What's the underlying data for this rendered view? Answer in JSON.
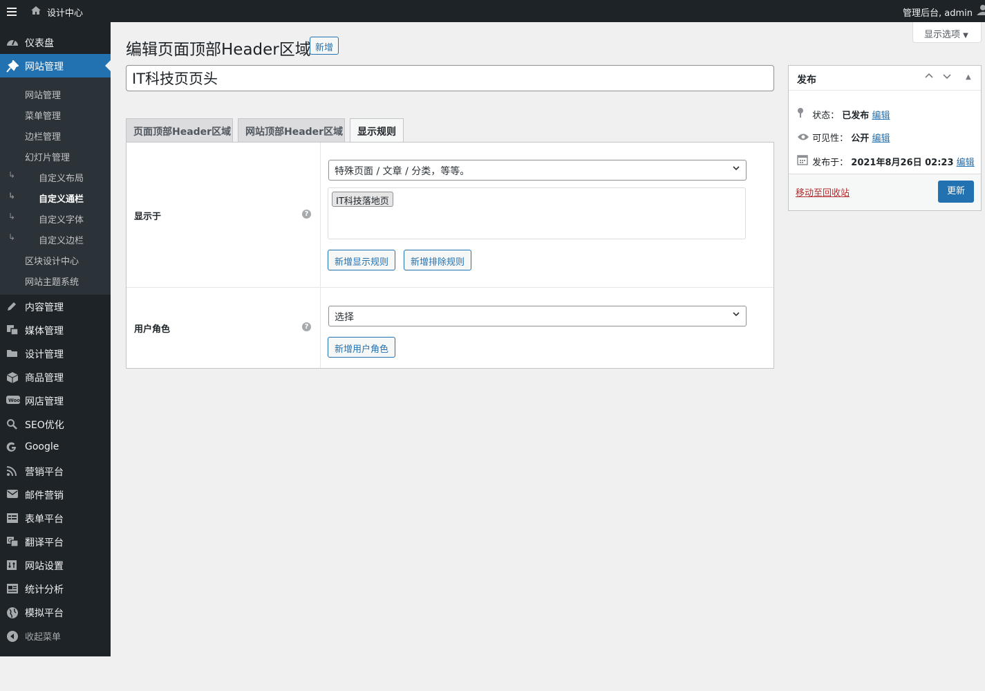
{
  "adminbar": {
    "site_name": "设计中心",
    "account": "管理后台, admin"
  },
  "sidebar": {
    "items_top": [
      {
        "label": "仪表盘",
        "icon": "dashboard-icon"
      },
      {
        "label": "网站管理",
        "icon": "pin-icon",
        "current": true
      }
    ],
    "submenu": [
      {
        "label": "网站管理"
      },
      {
        "label": "菜单管理"
      },
      {
        "label": "边栏管理"
      },
      {
        "label": "幻灯片管理"
      },
      {
        "label": "自定义布局",
        "indent": true
      },
      {
        "label": "自定义通栏",
        "indent": true,
        "active": true
      },
      {
        "label": "自定义字体",
        "indent": true
      },
      {
        "label": "自定义边栏",
        "indent": true
      },
      {
        "label": "区块设计中心"
      },
      {
        "label": "网站主题系统"
      }
    ],
    "items_bottom": [
      {
        "label": "内容管理",
        "icon": "edit-icon"
      },
      {
        "label": "媒体管理",
        "icon": "media-icon"
      },
      {
        "label": "设计管理",
        "icon": "folder-icon"
      },
      {
        "label": "商品管理",
        "icon": "box-icon"
      },
      {
        "label": "网店管理",
        "icon": "woo-icon"
      },
      {
        "label": "SEO优化",
        "icon": "search-icon"
      },
      {
        "label": "Google",
        "icon": "google-icon"
      },
      {
        "label": "营销平台",
        "icon": "rss-icon"
      },
      {
        "label": "邮件营销",
        "icon": "mail-icon"
      },
      {
        "label": "表单平台",
        "icon": "form-icon"
      },
      {
        "label": "翻译平台",
        "icon": "translate-icon"
      },
      {
        "label": "网站设置",
        "icon": "settings-icon"
      },
      {
        "label": "统计分析",
        "icon": "analytics-icon"
      },
      {
        "label": "模拟平台",
        "icon": "globe-icon"
      }
    ],
    "collapse_label": "收起菜单"
  },
  "screen_options": "显示选项",
  "page": {
    "title": "编辑页面顶部Header区域",
    "add_new": "新增",
    "post_title": "IT科技页页头"
  },
  "tabs": [
    {
      "label": "页面顶部Header区域"
    },
    {
      "label": "网站顶部Header区域"
    },
    {
      "label": "显示规则",
      "active": true
    }
  ],
  "rules": {
    "display_on_label": "显示于",
    "display_select": "特殊页面 / 文章 / 分类，等等。",
    "display_chip": "IT科技落地页",
    "add_display_rule": "新增显示规则",
    "add_exclude_rule": "新增排除规则",
    "user_role_label": "用户角色",
    "user_role_select": "选择",
    "add_user_role": "新增用户角色",
    "help_glyph": "?"
  },
  "publish": {
    "title": "发布",
    "status_label": "状态：",
    "status_value": "已发布",
    "visibility_label": "可见性：",
    "visibility_value": "公开",
    "published_label": "发布于：",
    "published_value": "2021年8月26日 02:23",
    "edit_link": "编辑",
    "trash": "移动至回收站",
    "update": "更新"
  },
  "colors": {
    "accent": "#2271b1",
    "sidebar_bg": "#1d2327",
    "danger": "#b32d2e"
  }
}
